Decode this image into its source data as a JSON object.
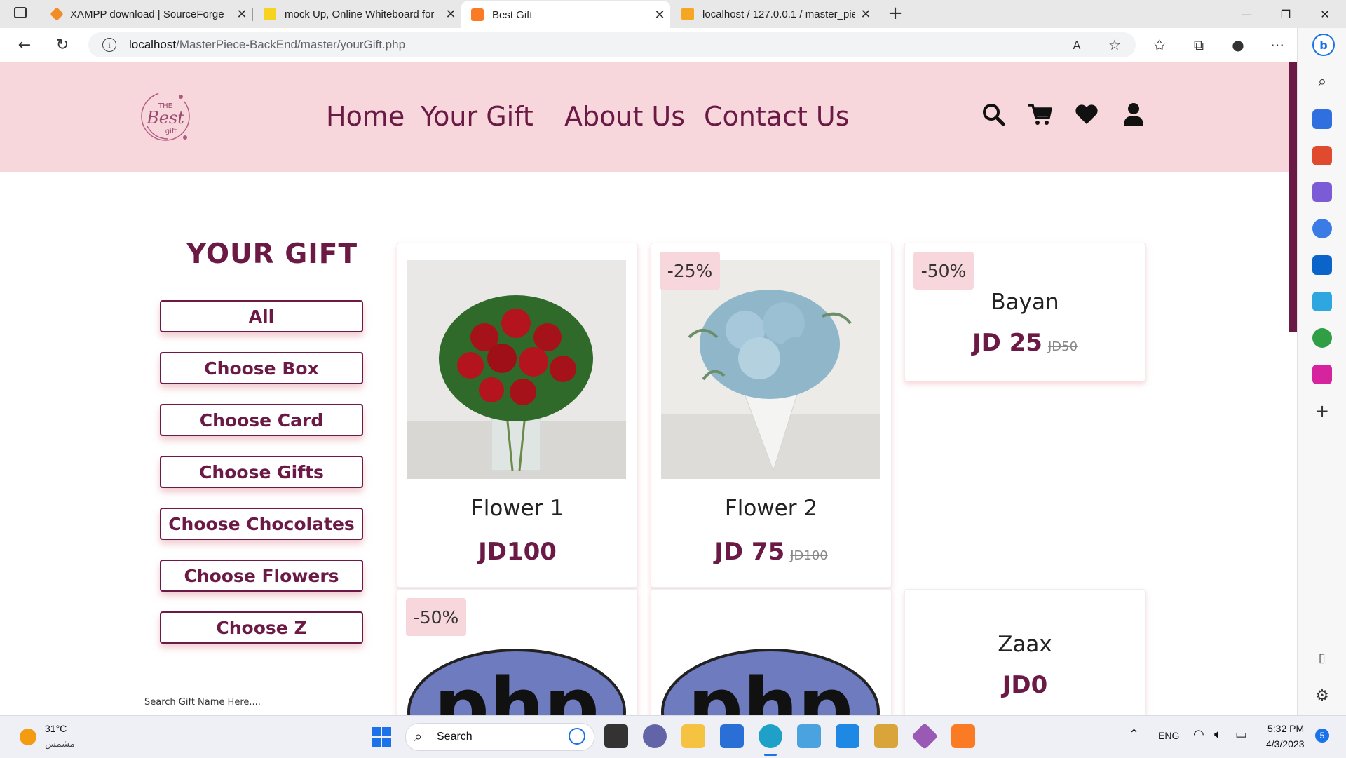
{
  "browser": {
    "tabs": [
      {
        "title": "XAMPP download | SourceForge",
        "color": "#f28c28"
      },
      {
        "title": "mock Up, Online Whiteboard for",
        "color": "#f7d21e"
      },
      {
        "title": "Best Gift",
        "color": "#fb7a24",
        "active": true
      },
      {
        "title": "localhost / 127.0.0.1 / master_pie",
        "color": "#f5a623"
      }
    ],
    "url_host": "localhost",
    "url_path": "/MasterPiece-BackEnd/master/yourGift.php"
  },
  "site": {
    "logo_top": "THE",
    "logo_main": "Best",
    "logo_bottom": "gift",
    "nav": [
      "Home",
      "Your Gift",
      "About Us",
      "Contact Us"
    ],
    "icons": [
      "search-icon",
      "cart-icon",
      "heart-icon",
      "user-icon"
    ],
    "accent": "#6b1a46",
    "header_bg": "#f8d7dc"
  },
  "sidebar_panel": {
    "title": "YOUR GIFT",
    "categories": [
      "All",
      "Choose Box",
      "Choose Card",
      "Choose Gifts",
      "Choose Chocolates",
      "Choose Flowers",
      "Choose Z"
    ],
    "search_placeholder": "Search Gift Name Here...."
  },
  "products": [
    {
      "name": "Flower 1",
      "price": "JD100",
      "old": "",
      "badge": "",
      "image": "red-roses"
    },
    {
      "name": "Flower 2",
      "price": "JD 75",
      "old": "JD100",
      "badge": "-25%",
      "image": "blue-hydrangea"
    },
    {
      "name": "Bayan",
      "price": "JD 25",
      "old": "JD50",
      "badge": "-50%",
      "image": ""
    },
    {
      "name": "",
      "price": "",
      "old": "",
      "badge": "-50%",
      "image": "php-logo"
    },
    {
      "name": "",
      "price": "",
      "old": "",
      "badge": "",
      "image": "php-logo"
    },
    {
      "name": "Zaax",
      "price": "JD0",
      "old": "",
      "badge": "",
      "image": ""
    }
  ],
  "taskbar": {
    "weather_temp": "31°C",
    "weather_desc": "مشمس",
    "search_label": "Search",
    "lang": "ENG",
    "time": "5:32 PM",
    "date": "4/3/2023",
    "notif_count": "5"
  }
}
